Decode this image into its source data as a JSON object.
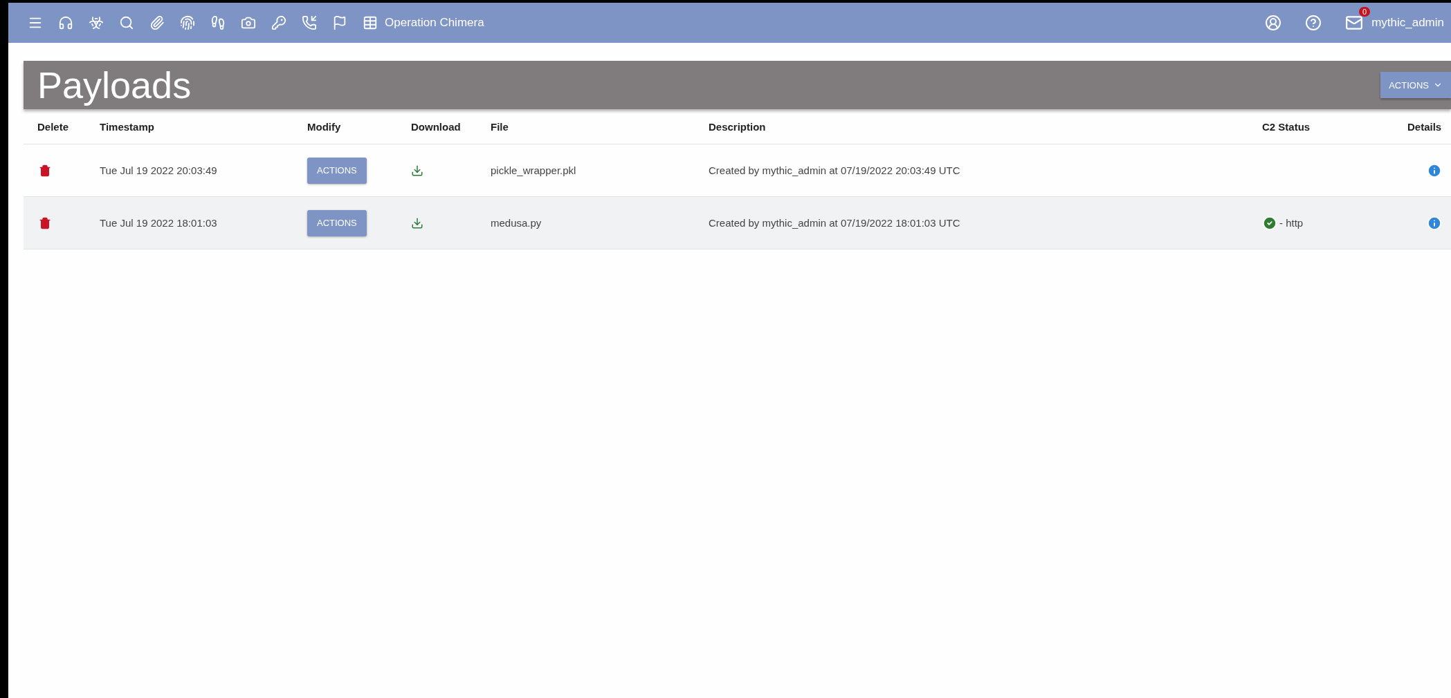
{
  "navbar": {
    "operation": "Operation Chimera",
    "mail_badge": "0",
    "username": "mythic_admin"
  },
  "header": {
    "title": "Payloads",
    "actions_button": "ACTIONS"
  },
  "table": {
    "columns": [
      "Delete",
      "Timestamp",
      "Modify",
      "Download",
      "File",
      "Description",
      "C2 Status",
      "Details"
    ],
    "rows": [
      {
        "timestamp": "Tue Jul 19 2022 20:03:49",
        "modify": "ACTIONS",
        "file": "pickle_wrapper.pkl",
        "description": "Created by mythic_admin at 07/19/2022 20:03:49 UTC",
        "c2_ok": false,
        "highlighted": false
      },
      {
        "timestamp": "Tue Jul 19 2022 18:01:03",
        "modify": "ACTIONS",
        "file": "medusa.py",
        "description": "Created by mythic_admin at 07/19/2022 18:01:03 UTC",
        "c2_ok": true,
        "c2_status": "- http",
        "highlighted": true
      }
    ]
  }
}
